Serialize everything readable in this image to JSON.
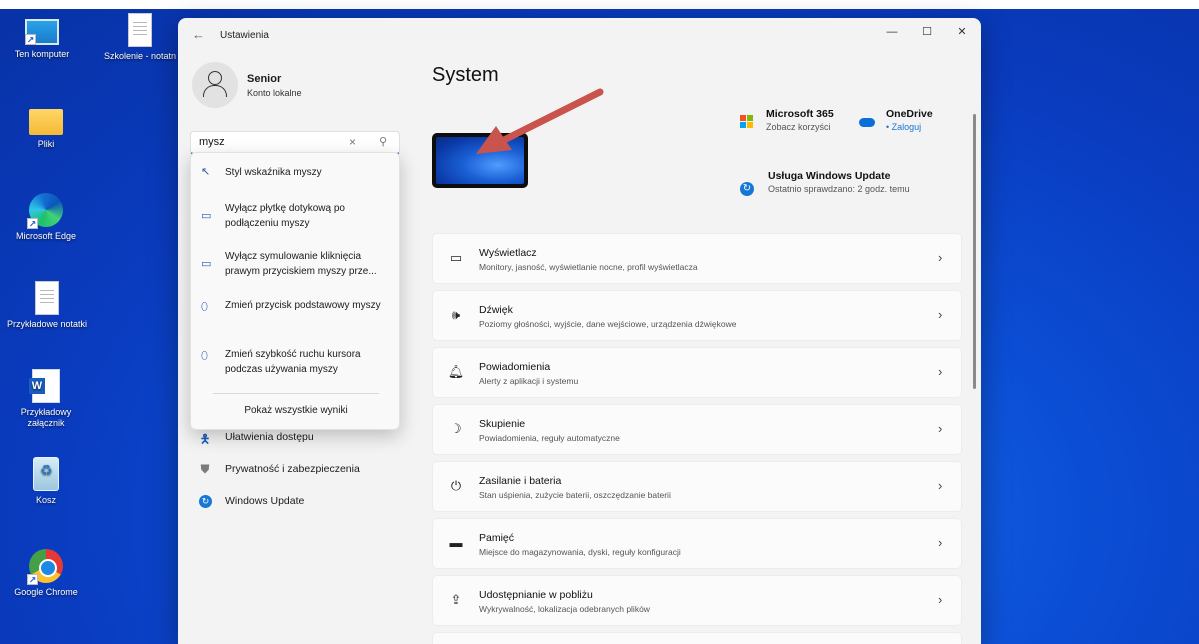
{
  "desktop": {
    "icons": [
      {
        "label": "Ten komputer",
        "icon": "computer-icon"
      },
      {
        "label": "Szkolenie - notatn",
        "icon": "document-icon"
      },
      {
        "label": "Pliki",
        "icon": "folder-icon"
      },
      {
        "label": "Microsoft Edge",
        "icon": "edge-icon"
      },
      {
        "label": "Przykładowe notatki",
        "icon": "document-icon"
      },
      {
        "label": "Przykładowy załącznik",
        "icon": "word-icon"
      },
      {
        "label": "Kosz",
        "icon": "recycle-bin-icon"
      },
      {
        "label": "Google Chrome",
        "icon": "chrome-icon"
      }
    ]
  },
  "window": {
    "title": "Ustawienia",
    "back_icon": "←",
    "minimize_icon": "—",
    "maximize_icon": "☐",
    "close_icon": "✕"
  },
  "profile": {
    "name": "Senior",
    "account_type": "Konto lokalne"
  },
  "search": {
    "value": "mysz",
    "clear_icon": "×",
    "search_icon": "⚲"
  },
  "suggestions": [
    {
      "icon": "pointer-style-icon",
      "glyph": "↖",
      "text": "Styl wskaźnika myszy"
    },
    {
      "icon": "touchpad-icon",
      "glyph": "▭",
      "text": "Wyłącz płytkę dotykową po podłączeniu myszy"
    },
    {
      "icon": "touchpad-icon",
      "glyph": "▭",
      "text": "Wyłącz symulowanie kliknięcia prawym przyciskiem myszy prze..."
    },
    {
      "icon": "mouse-icon",
      "glyph": "🖱",
      "text": "Zmień przycisk podstawowy myszy"
    },
    {
      "icon": "mouse-icon",
      "glyph": "🖱",
      "text": "Zmień szybkość ruchu kursora podczas używania myszy"
    }
  ],
  "show_all_results": "Pokaż wszystkie wyniki",
  "nav": [
    {
      "label": "Ułatwienia dostępu",
      "glyph": "✦",
      "icon": "accessibility-icon",
      "color": "#1a5cbe"
    },
    {
      "label": "Prywatność i zabezpieczenia",
      "glyph": "⛊",
      "icon": "shield-icon",
      "color": "#7b7b7b"
    },
    {
      "label": "Windows Update",
      "glyph": "↻",
      "icon": "windows-update-icon",
      "color": "#1677d7"
    }
  ],
  "main": {
    "title": "System",
    "microsoft365": {
      "title": "Microsoft 365",
      "subtitle": "Zobacz korzyści"
    },
    "onedrive": {
      "title": "OneDrive",
      "subtitle": "• Zaloguj"
    },
    "windows_update": {
      "title": "Usługa Windows Update",
      "subtitle": "Ostatnio sprawdzano: 2 godz. temu"
    },
    "cards": [
      {
        "title": "Wyświetlacz",
        "desc": "Monitory, jasność, wyświetlanie nocne, profil wyświetlacza",
        "glyph": "▭",
        "icon": "display-icon"
      },
      {
        "title": "Dźwięk",
        "desc": "Poziomy głośności, wyjście, dane wejściowe, urządzenia dźwiękowe",
        "glyph": "🔈",
        "icon": "sound-icon"
      },
      {
        "title": "Powiadomienia",
        "desc": "Alerty z aplikacji i systemu",
        "glyph": "🔔",
        "icon": "notifications-icon"
      },
      {
        "title": "Skupienie",
        "desc": "Powiadomienia, reguły automatyczne",
        "glyph": "☽",
        "icon": "focus-icon"
      },
      {
        "title": "Zasilanie i bateria",
        "desc": "Stan uśpienia, zużycie baterii, oszczędzanie baterii",
        "glyph": "⏻",
        "icon": "power-icon"
      },
      {
        "title": "Pamięć",
        "desc": "Miejsce do magazynowania, dyski, reguły konfiguracji",
        "glyph": "▬",
        "icon": "storage-icon"
      },
      {
        "title": "Udostępnianie w pobliżu",
        "desc": "Wykrywalność, lokalizacja odebranych plików",
        "glyph": "⇪",
        "icon": "nearby-sharing-icon"
      }
    ],
    "chevron": "›"
  },
  "colors": {
    "accent": "#2a6bd1",
    "arrow": "#c9534d",
    "desktop": "#0a3cc0"
  }
}
